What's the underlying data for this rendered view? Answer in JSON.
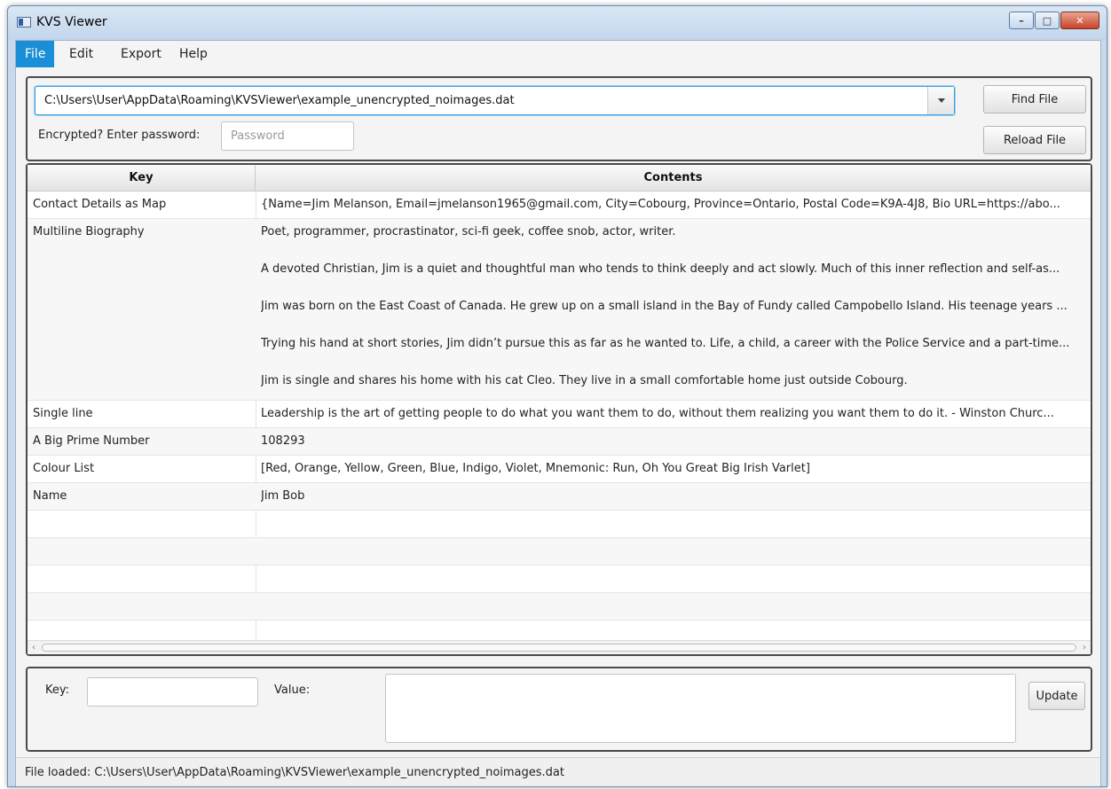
{
  "window": {
    "title": "KVS Viewer",
    "controls": {
      "minimize": "–",
      "maximize": "□",
      "close": "✕"
    }
  },
  "menu": {
    "items": [
      {
        "label": "File",
        "active": true
      },
      {
        "label": "Edit",
        "active": false
      },
      {
        "label": "Export",
        "active": false
      },
      {
        "label": "Help",
        "active": false
      }
    ]
  },
  "file_panel": {
    "path_value": "C:\\Users\\User\\AppData\\Roaming\\KVSViewer\\example_unencrypted_noimages.dat",
    "find_button": "Find File",
    "reload_button": "Reload File",
    "password_label": "Encrypted? Enter password:",
    "password_placeholder": "Password"
  },
  "table": {
    "headers": {
      "key": "Key",
      "contents": "Contents"
    },
    "rows": [
      {
        "key": "Contact Details as Map",
        "contents": "{Name=Jim Melanson, Email=jmelanson1965@gmail.com, City=Cobourg, Province=Ontario, Postal Code=K9A-4J8, Bio URL=https://abo..."
      },
      {
        "key": "Multiline Biography",
        "lines": [
          "Poet, programmer, procrastinator, sci-fi geek, coffee snob, actor, writer.",
          "A devoted Christian, Jim is a quiet and thoughtful man who tends to think deeply and act slowly. Much of this inner reflection and self-as...",
          "Jim was born on the East Coast of Canada. He grew up on a small island in the Bay of Fundy called Campobello Island. His teenage years ...",
          "Trying his hand at short stories, Jim didn’t pursue this as far as he wanted to. Life, a child, a career with the Police Service and a part-time...",
          "Jim is single and shares his home with his cat Cleo. They live in a small comfortable home just outside Cobourg."
        ]
      },
      {
        "key": "Single line",
        "contents": "Leadership is the art of getting people to do what you want them to do, without them realizing you want them to do it. - Winston Churc..."
      },
      {
        "key": "A Big Prime Number",
        "contents": "108293"
      },
      {
        "key": "Colour List",
        "contents": "[Red, Orange, Yellow, Green, Blue, Indigo, Violet, Mnemonic: Run, Oh You Great Big Irish Varlet]"
      },
      {
        "key": "Name",
        "contents": "Jim Bob"
      }
    ]
  },
  "editor": {
    "key_label": "Key:",
    "key_value": "",
    "value_label": "Value:",
    "value_text": "",
    "update_button": "Update"
  },
  "status": {
    "text": "File loaded: C:\\Users\\User\\AppData\\Roaming\\KVSViewer\\example_unencrypted_noimages.dat"
  }
}
